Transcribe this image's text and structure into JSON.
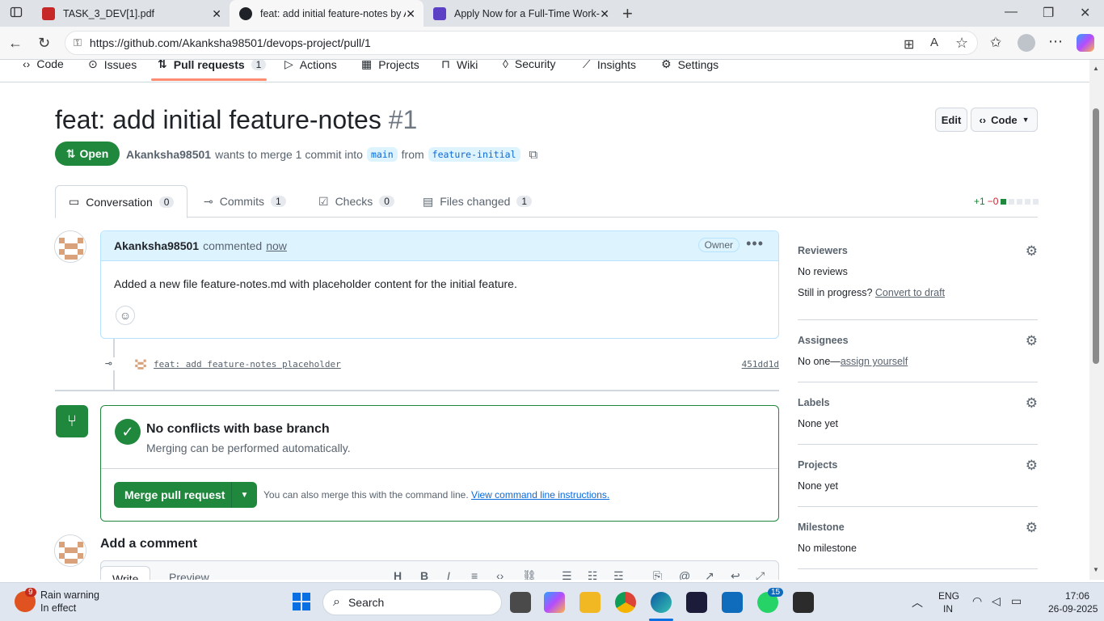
{
  "browser": {
    "tabs": [
      {
        "title": "TASK_3_DEV[1].pdf"
      },
      {
        "title": "feat: add initial feature-notes by A"
      },
      {
        "title": "Apply Now for a Full-Time Work-f"
      }
    ],
    "url": "https://github.com/Akanksha98501/devops-project/pull/1"
  },
  "repo_nav": {
    "items": [
      "Code",
      "Issues",
      "Pull requests",
      "Actions",
      "Projects",
      "Wiki",
      "Security",
      "Insights",
      "Settings"
    ],
    "pr_count": "1"
  },
  "pr": {
    "title": "feat: add initial feature-notes",
    "number": "#1",
    "edit_label": "Edit",
    "code_label": "Code",
    "state": "Open",
    "author": "Akanksha98501",
    "merge_text": "wants to merge 1 commit into",
    "base": "main",
    "from_text": "from",
    "head": "feature-initial",
    "tabs": [
      {
        "label": "Conversation",
        "count": "0"
      },
      {
        "label": "Commits",
        "count": "1"
      },
      {
        "label": "Checks",
        "count": "0"
      },
      {
        "label": "Files changed",
        "count": "1"
      }
    ],
    "additions": "+1",
    "deletions": "−0"
  },
  "comment": {
    "author": "Akanksha98501",
    "action": "commented",
    "time": "now",
    "role": "Owner",
    "body": "Added a new file feature-notes.md with placeholder content for the initial feature."
  },
  "commit": {
    "message": "feat: add feature-notes placeholder",
    "sha": "451dd1d"
  },
  "merge": {
    "title": "No conflicts with base branch",
    "subtitle": "Merging can be performed automatically.",
    "button": "Merge pull request",
    "cmd_text": "You can also merge this with the command line.",
    "cmd_link": "View command line instructions."
  },
  "add_comment": {
    "title": "Add a comment",
    "write": "Write",
    "preview": "Preview"
  },
  "sidebar": {
    "reviewers": {
      "label": "Reviewers",
      "value": "No reviews",
      "progress": "Still in progress?",
      "link": "Convert to draft"
    },
    "assignees": {
      "label": "Assignees",
      "value": "No one—",
      "link": "assign yourself"
    },
    "labels": {
      "label": "Labels",
      "value": "None yet"
    },
    "projects": {
      "label": "Projects",
      "value": "None yet"
    },
    "milestone": {
      "label": "Milestone",
      "value": "No milestone"
    }
  },
  "taskbar": {
    "weather_badge": "9",
    "weather_title": "Rain warning",
    "weather_sub": "In effect",
    "search": "Search",
    "whatsapp_badge": "15",
    "lang": "ENG",
    "region": "IN",
    "time": "17:06",
    "date": "26-09-2025"
  }
}
